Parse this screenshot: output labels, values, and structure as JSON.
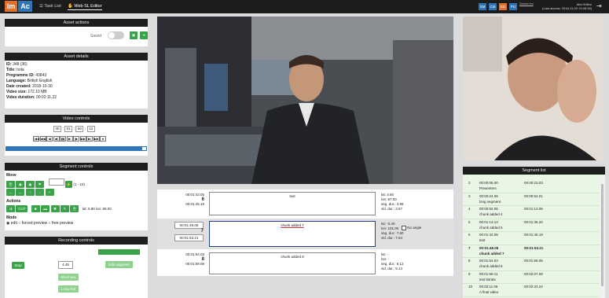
{
  "app": {
    "logo_left": "Im",
    "logo_right": "Ac",
    "nav_task_list": "Task List",
    "nav_editor": "Web SL Editor",
    "user_menu_label": "Session list"
  },
  "users": [
    {
      "abbr": "SM",
      "color": "#2f74b5"
    },
    {
      "abbr": "CM",
      "color": "#2f74b5"
    },
    {
      "abbr": "ED",
      "color": "#e2702a"
    },
    {
      "abbr": "PU",
      "color": "#2f74b5"
    }
  ],
  "user": {
    "name": "Alex Editor",
    "last_access": "(Last access: 2018-11-03 13:48:35)"
  },
  "asset_actions": {
    "title": "Asset actions",
    "saved_label": "Saved"
  },
  "asset_details": {
    "title": "Asset details",
    "rows": [
      {
        "k": "ID:",
        "v": "348 (36)"
      },
      {
        "k": "Title:",
        "v": "hola"
      },
      {
        "k": "Programme ID:",
        "v": "43843"
      },
      {
        "k": "Language:",
        "v": "British English"
      },
      {
        "k": "Date created:",
        "v": "2018-10-30"
      },
      {
        "k": "Video size:",
        "v": "172.10 MB"
      },
      {
        "k": "Video duration:",
        "v": "00:02:11.22"
      }
    ]
  },
  "video_controls": {
    "title": "Video controls",
    "time": [
      "00",
      "01",
      "50",
      "13"
    ],
    "buttons": [
      "|◀◀",
      "◀◀",
      "◀",
      "◀|",
      "▮▮",
      "▶",
      "|▶",
      "▶▶",
      "▶|",
      "▶▶|",
      "⏹"
    ],
    "progress": 0.97
  },
  "segment_controls": {
    "title": "Segment controls",
    "move_label": "Move",
    "range": "(1 - 10)",
    "actions_label": "Actions",
    "cut_label": "CUT",
    "lat_lon": "lat: 9.80 lon: 89.00",
    "mode_label": "Mode",
    "modes": [
      "edit",
      "forced preview",
      "free preview"
    ]
  },
  "recording_controls": {
    "title": "Recording controls",
    "stop": "Stop",
    "value": "4.45",
    "edit_segment": "Edit segment",
    "short_text": "Short text",
    "long_text": "Long text"
  },
  "timeline": {
    "prev": {
      "start": "00:01:42.05",
      "num": "6",
      "end": "00:01:45.19",
      "text": "test",
      "lat": "lat: 4.60",
      "lon": "lon: 87.00",
      "seg_dur": "seg. dur.: 3.98",
      "vid_dur": "vid. dur.: 3.57"
    },
    "cur": {
      "start": "00:01:46.06",
      "num": "7",
      "end": "00:01:53.21",
      "text": "chunk added 7",
      "lat": "lat: -0.40",
      "lon": "lon: 101.00",
      "seg_dur": "seg. dur.: 7.60",
      "vid_dur": "vid. dur.: 7.64",
      "no_angle": "No angle"
    },
    "next": {
      "start": "00:01:54.03",
      "num": "8",
      "end": "00:01:59.06",
      "text": "chunk added 8",
      "lat": "lat: -",
      "lon": "lon: -",
      "seg_dur": "seg. dur.: 5.12",
      "vid_dur": "vid. dur.: 5.14"
    }
  },
  "segment_list": {
    "title": "Segment list",
    "rows": [
      {
        "n": "2",
        "start": "00:00:06.00",
        "end": "00:00:23.03",
        "text": "Presenters"
      },
      {
        "n": "3",
        "start": "00:00:24.08",
        "end": "00:00:52.01",
        "text": "long segment"
      },
      {
        "n": "4",
        "start": "00:00:52.06",
        "end": "00:01:13.06",
        "text": "chunk added 4"
      },
      {
        "n": "5",
        "start": "00:01:13.13",
        "end": "00:01:35.20",
        "text": "chunk added 5"
      },
      {
        "n": "6",
        "start": "00:01:42.05",
        "end": "00:01:45.19",
        "text": "test"
      },
      {
        "n": "7",
        "start": "00:01:46.06",
        "end": "00:01:53.21",
        "text": "chunk added 7"
      },
      {
        "n": "8",
        "start": "00:01:54.03",
        "end": "00:01:59.06",
        "text": "chunk added 8"
      },
      {
        "n": "9",
        "start": "00:01:59.11",
        "end": "00:02:07.08",
        "text": "test bitrate"
      },
      {
        "n": "10",
        "start": "00:02:11.06",
        "end": "00:02:24.24",
        "text": "A final video"
      }
    ]
  }
}
